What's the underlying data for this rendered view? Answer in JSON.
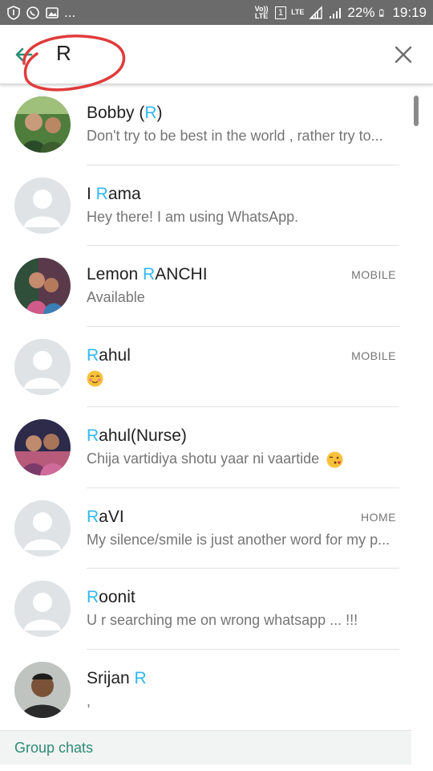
{
  "status_bar": {
    "left_icons": [
      "shield-icon",
      "whatsapp-icon",
      "gallery-icon"
    ],
    "overflow": "...",
    "volte": "Vo)) LTE",
    "sim": "1",
    "lte": "LTE",
    "battery_pct": "22%",
    "time": "19:19"
  },
  "search": {
    "query": "R",
    "back_icon": "back-arrow-icon",
    "close_icon": "close-icon",
    "annotation_color": "#e03b3b"
  },
  "colors": {
    "highlight": "#34b7f1",
    "accent": "#2e8b74"
  },
  "contacts": [
    {
      "name_pre": "Bobby (",
      "name_hl": "R",
      "name_post": ")",
      "status": "Don't try to be best in the world , rather try to...",
      "label": ""
    },
    {
      "name_pre": "I ",
      "name_hl": "R",
      "name_post": "ama",
      "status": "Hey there! I am using WhatsApp.",
      "label": ""
    },
    {
      "name_pre": "Lemon ",
      "name_hl": "R",
      "name_post": "ANCHI",
      "status": "Available",
      "label": "MOBILE"
    },
    {
      "name_pre": "",
      "name_hl": "R",
      "name_post": "ahul",
      "status": "",
      "label": "MOBILE"
    },
    {
      "name_pre": "",
      "name_hl": "R",
      "name_post": "ahul(Nurse)",
      "status": "Chija vartidiya shotu yaar ni vaartide",
      "label": ""
    },
    {
      "name_pre": "",
      "name_hl": "R",
      "name_post": "aVI",
      "status": "My silence/smile is just another word for my p...",
      "label": "HOME"
    },
    {
      "name_pre": "",
      "name_hl": "R",
      "name_post": "oonit",
      "status": "U r searching me on wrong whatsapp ... !!!",
      "label": ""
    },
    {
      "name_pre": "Srijan ",
      "name_hl": "R",
      "name_post": "",
      "status": ",",
      "label": ""
    }
  ],
  "group_chats": {
    "label": "Group chats"
  }
}
